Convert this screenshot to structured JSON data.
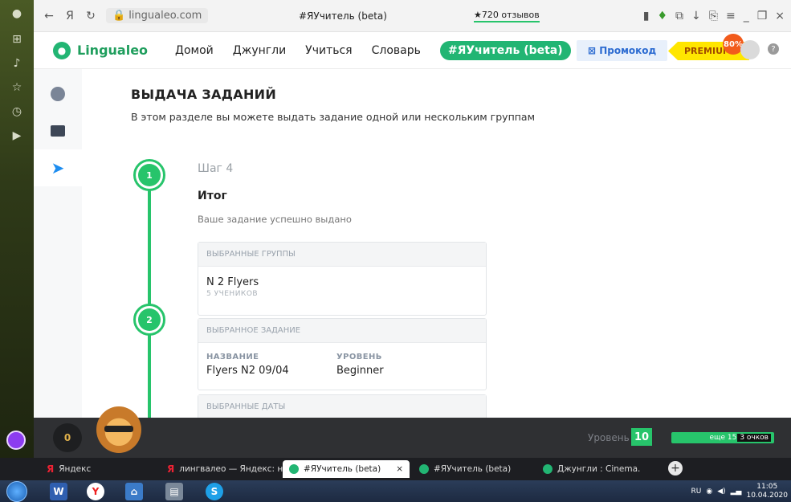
{
  "browser": {
    "url": "lingualeo.com",
    "tab_title": "#ЯУчитель (beta)",
    "reviews": "★720 отзывов"
  },
  "header": {
    "logo": "Lingualeo",
    "nav": [
      "Домой",
      "Джунгли",
      "Учиться",
      "Словарь",
      "#ЯУчитель (beta)"
    ],
    "promo": "Промокод",
    "premium": "PREMIUM",
    "discount": "80%"
  },
  "page": {
    "title": "ВЫДАЧА ЗАДАНИЙ",
    "subtitle": "В этом разделе вы можете выдать задание одной или нескольким группам",
    "step_label": "Шаг 4",
    "result_title": "Итог",
    "success": "Ваше задание успешно выдано",
    "steps": [
      "1",
      "2"
    ],
    "groups_card": {
      "header": "ВЫБРАННЫЕ ГРУППЫ",
      "group_name": "N 2 Flyers",
      "group_count": "5 УЧЕНИКОВ"
    },
    "task_card": {
      "header": "ВЫБРАННОЕ ЗАДАНИЕ",
      "name_label": "НАЗВАНИЕ",
      "name_value": "Flyers N2 09/04",
      "level_label": "УРОВЕНЬ",
      "level_value": "Beginner"
    },
    "dates_card": {
      "header": "ВЫБРАННЫЕ ДАТЫ"
    }
  },
  "gamebar": {
    "coins": "0",
    "level_word": "Уровень",
    "level": "10",
    "points_text": "еще 15",
    "points_rest": "3 очков"
  },
  "tabs": [
    {
      "icon": "Я",
      "label": "Яндекс"
    },
    {
      "icon": "Я",
      "label": "лингвалео — Яндекс: наш"
    },
    {
      "label": "#ЯУчитель (beta)",
      "close": "×"
    },
    {
      "label": "#ЯУчитель (beta)"
    },
    {
      "label": "Джунгли : Cinema."
    }
  ],
  "taskbar": {
    "lang": "RU",
    "time": "11:05",
    "date": "10.04.2020"
  }
}
